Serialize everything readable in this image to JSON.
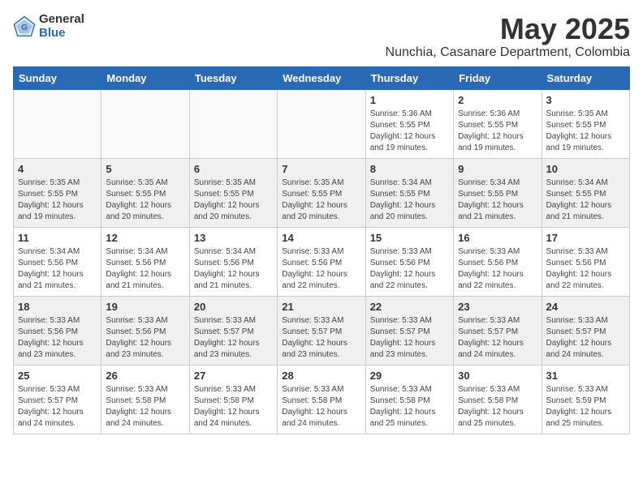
{
  "logo": {
    "general": "General",
    "blue": "Blue"
  },
  "header": {
    "month": "May 2025",
    "location": "Nunchia, Casanare Department, Colombia"
  },
  "weekdays": [
    "Sunday",
    "Monday",
    "Tuesday",
    "Wednesday",
    "Thursday",
    "Friday",
    "Saturday"
  ],
  "weeks": [
    [
      {
        "day": "",
        "info": ""
      },
      {
        "day": "",
        "info": ""
      },
      {
        "day": "",
        "info": ""
      },
      {
        "day": "",
        "info": ""
      },
      {
        "day": "1",
        "info": "Sunrise: 5:36 AM\nSunset: 5:55 PM\nDaylight: 12 hours\nand 19 minutes."
      },
      {
        "day": "2",
        "info": "Sunrise: 5:36 AM\nSunset: 5:55 PM\nDaylight: 12 hours\nand 19 minutes."
      },
      {
        "day": "3",
        "info": "Sunrise: 5:35 AM\nSunset: 5:55 PM\nDaylight: 12 hours\nand 19 minutes."
      }
    ],
    [
      {
        "day": "4",
        "info": "Sunrise: 5:35 AM\nSunset: 5:55 PM\nDaylight: 12 hours\nand 19 minutes."
      },
      {
        "day": "5",
        "info": "Sunrise: 5:35 AM\nSunset: 5:55 PM\nDaylight: 12 hours\nand 20 minutes."
      },
      {
        "day": "6",
        "info": "Sunrise: 5:35 AM\nSunset: 5:55 PM\nDaylight: 12 hours\nand 20 minutes."
      },
      {
        "day": "7",
        "info": "Sunrise: 5:35 AM\nSunset: 5:55 PM\nDaylight: 12 hours\nand 20 minutes."
      },
      {
        "day": "8",
        "info": "Sunrise: 5:34 AM\nSunset: 5:55 PM\nDaylight: 12 hours\nand 20 minutes."
      },
      {
        "day": "9",
        "info": "Sunrise: 5:34 AM\nSunset: 5:55 PM\nDaylight: 12 hours\nand 21 minutes."
      },
      {
        "day": "10",
        "info": "Sunrise: 5:34 AM\nSunset: 5:55 PM\nDaylight: 12 hours\nand 21 minutes."
      }
    ],
    [
      {
        "day": "11",
        "info": "Sunrise: 5:34 AM\nSunset: 5:56 PM\nDaylight: 12 hours\nand 21 minutes."
      },
      {
        "day": "12",
        "info": "Sunrise: 5:34 AM\nSunset: 5:56 PM\nDaylight: 12 hours\nand 21 minutes."
      },
      {
        "day": "13",
        "info": "Sunrise: 5:34 AM\nSunset: 5:56 PM\nDaylight: 12 hours\nand 21 minutes."
      },
      {
        "day": "14",
        "info": "Sunrise: 5:33 AM\nSunset: 5:56 PM\nDaylight: 12 hours\nand 22 minutes."
      },
      {
        "day": "15",
        "info": "Sunrise: 5:33 AM\nSunset: 5:56 PM\nDaylight: 12 hours\nand 22 minutes."
      },
      {
        "day": "16",
        "info": "Sunrise: 5:33 AM\nSunset: 5:56 PM\nDaylight: 12 hours\nand 22 minutes."
      },
      {
        "day": "17",
        "info": "Sunrise: 5:33 AM\nSunset: 5:56 PM\nDaylight: 12 hours\nand 22 minutes."
      }
    ],
    [
      {
        "day": "18",
        "info": "Sunrise: 5:33 AM\nSunset: 5:56 PM\nDaylight: 12 hours\nand 23 minutes."
      },
      {
        "day": "19",
        "info": "Sunrise: 5:33 AM\nSunset: 5:56 PM\nDaylight: 12 hours\nand 23 minutes."
      },
      {
        "day": "20",
        "info": "Sunrise: 5:33 AM\nSunset: 5:57 PM\nDaylight: 12 hours\nand 23 minutes."
      },
      {
        "day": "21",
        "info": "Sunrise: 5:33 AM\nSunset: 5:57 PM\nDaylight: 12 hours\nand 23 minutes."
      },
      {
        "day": "22",
        "info": "Sunrise: 5:33 AM\nSunset: 5:57 PM\nDaylight: 12 hours\nand 23 minutes."
      },
      {
        "day": "23",
        "info": "Sunrise: 5:33 AM\nSunset: 5:57 PM\nDaylight: 12 hours\nand 24 minutes."
      },
      {
        "day": "24",
        "info": "Sunrise: 5:33 AM\nSunset: 5:57 PM\nDaylight: 12 hours\nand 24 minutes."
      }
    ],
    [
      {
        "day": "25",
        "info": "Sunrise: 5:33 AM\nSunset: 5:57 PM\nDaylight: 12 hours\nand 24 minutes."
      },
      {
        "day": "26",
        "info": "Sunrise: 5:33 AM\nSunset: 5:58 PM\nDaylight: 12 hours\nand 24 minutes."
      },
      {
        "day": "27",
        "info": "Sunrise: 5:33 AM\nSunset: 5:58 PM\nDaylight: 12 hours\nand 24 minutes."
      },
      {
        "day": "28",
        "info": "Sunrise: 5:33 AM\nSunset: 5:58 PM\nDaylight: 12 hours\nand 24 minutes."
      },
      {
        "day": "29",
        "info": "Sunrise: 5:33 AM\nSunset: 5:58 PM\nDaylight: 12 hours\nand 25 minutes."
      },
      {
        "day": "30",
        "info": "Sunrise: 5:33 AM\nSunset: 5:58 PM\nDaylight: 12 hours\nand 25 minutes."
      },
      {
        "day": "31",
        "info": "Sunrise: 5:33 AM\nSunset: 5:59 PM\nDaylight: 12 hours\nand 25 minutes."
      }
    ]
  ]
}
